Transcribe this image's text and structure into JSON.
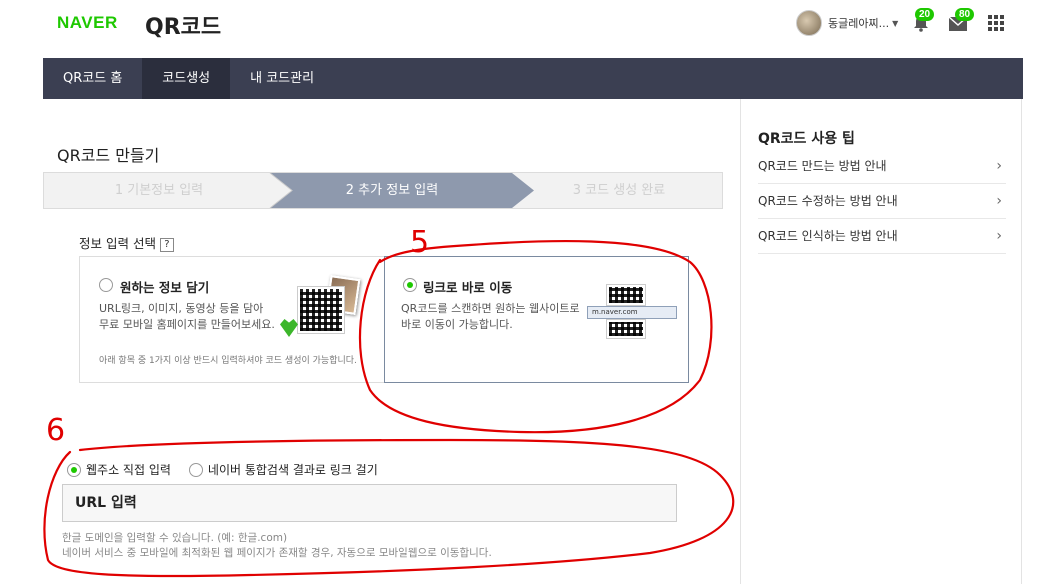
{
  "header": {
    "logo": "NAVER",
    "service_title": "QR코드",
    "user_name": "동글레아찌...",
    "notification_count": "20",
    "mail_count": "80"
  },
  "nav": {
    "items": [
      {
        "label": "QR코드 홈"
      },
      {
        "label": "코드생성"
      },
      {
        "label": "내 코드관리"
      }
    ]
  },
  "main": {
    "title": "QR코드 만들기",
    "steps": [
      {
        "label": "1 기본정보 입력"
      },
      {
        "label": "2 추가 정보 입력"
      },
      {
        "label": "3 코드 생성 완료"
      }
    ],
    "section_label": "정보 입력 선택",
    "help_mark": "?",
    "option_a": {
      "title": "원하는 정보 담기",
      "desc_line1": "URL링크, 이미지, 동영상 등을 담아",
      "desc_line2": "무료 모바일 홈페이지를 만들어보세요.",
      "note": "아래 항목 중 1가지 이상 반드시 입력하셔야 코드 생성이 가능합니다."
    },
    "option_b": {
      "title": "링크로 바로 이동",
      "desc_line1": "QR코드를 스캔하면 원하는 웹사이트로",
      "desc_line2": "바로 이동이 가능합니다.",
      "url_example": "m.naver.com"
    },
    "link_type": {
      "direct_label": "웹주소 직접 입력",
      "search_label": "네이버 통합검색 결과로 링크 걸기"
    },
    "url_input": {
      "placeholder": "URL 입력"
    },
    "hint_line1": "한글 도메인을 입력할 수 있습니다. (예: 한글.com)",
    "hint_line2": "네이버 서비스 중 모바일에 최적화된 웹 페이지가 존재할 경우, 자동으로 모바일웹으로 이동합니다."
  },
  "annotations": {
    "mark_5": "5",
    "mark_6": "6",
    "color": "#e00000"
  },
  "sidebar": {
    "title": "QR코드 사용 팁",
    "items": [
      {
        "label": "QR코드 만드는 방법 안내"
      },
      {
        "label": "QR코드 수정하는 방법 안내"
      },
      {
        "label": "QR코드 인식하는 방법 안내"
      }
    ]
  },
  "colors": {
    "brand": "#1ec800",
    "nav_bg": "#3b3f52",
    "step_active": "#8e99ad"
  }
}
